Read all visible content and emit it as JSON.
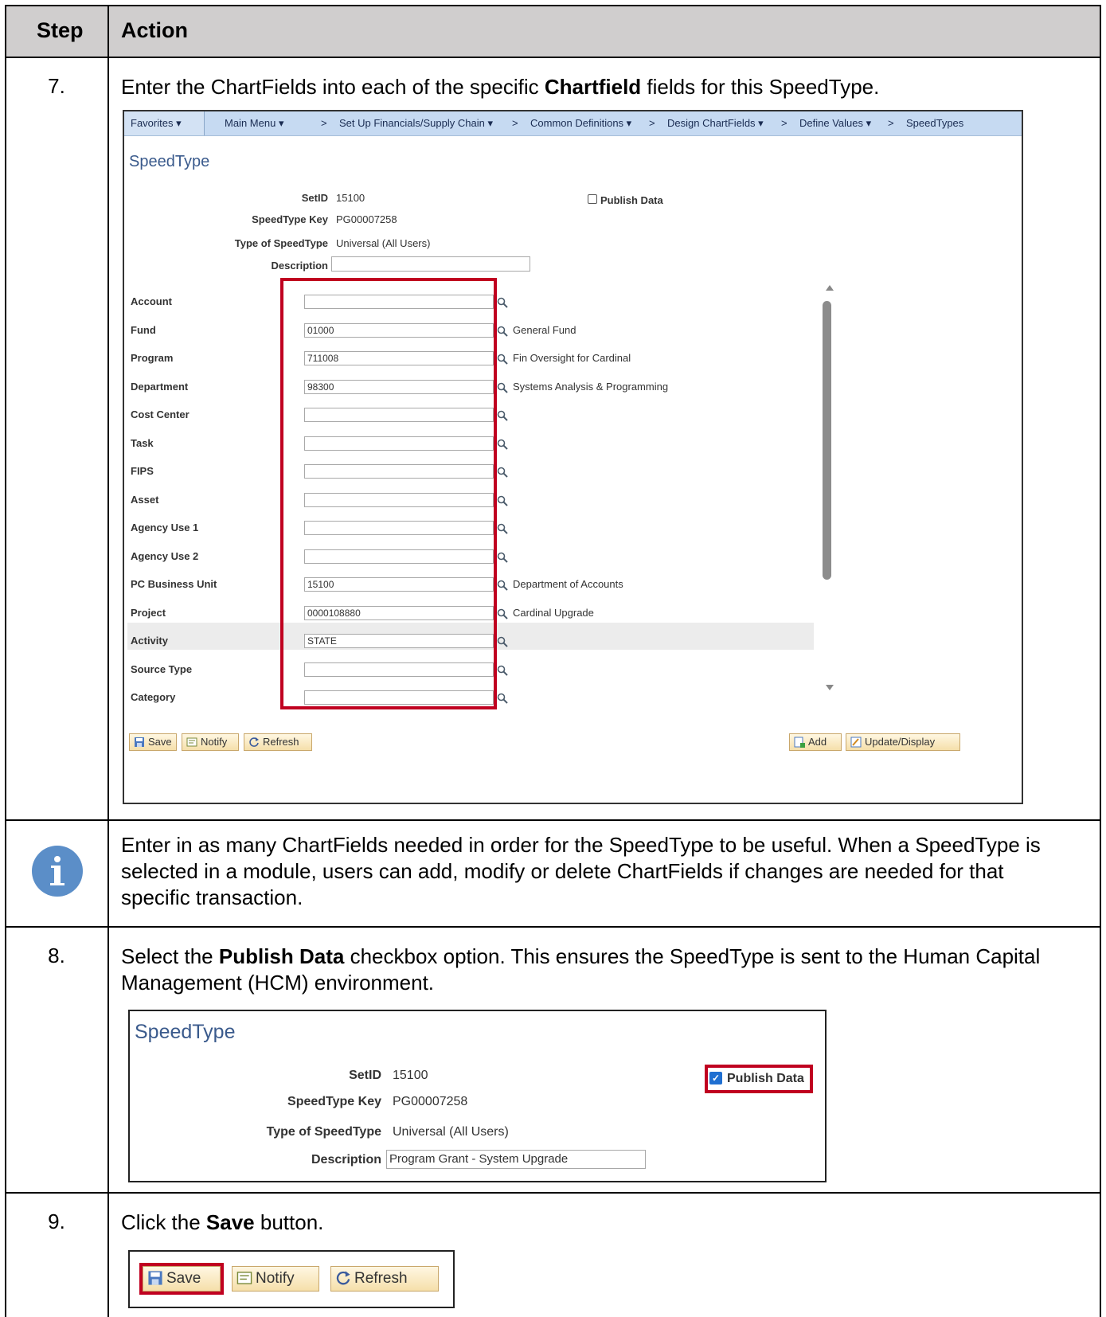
{
  "header": {
    "step": "Step",
    "action": "Action"
  },
  "rows": [
    {
      "step": "7.",
      "pre": "Enter the ChartFields into each of the specific ",
      "bold": "Chartfield",
      "post": " fields for this SpeedType."
    },
    {
      "note": "Enter in as many ChartFields needed in order for the SpeedType to be useful. When a SpeedType is selected in a module, users can add, modify or delete ChartFields if changes are needed for that specific transaction."
    },
    {
      "step": "8.",
      "pre": "Select the ",
      "bold": "Publish Data",
      "post": " checkbox option. This ensures the SpeedType is sent to the Human Capital Management (HCM) environment."
    },
    {
      "step": "9.",
      "pre": "Click the ",
      "bold": "Save",
      "post": " button."
    }
  ],
  "nav": {
    "favorites": "Favorites",
    "main_menu": "Main Menu",
    "crumbs": [
      "Set Up Financials/Supply Chain",
      "Common Definitions",
      "Design ChartFields",
      "Define Values",
      "SpeedTypes"
    ],
    "sep": ">",
    "caret": "▾"
  },
  "form1": {
    "title": "SpeedType",
    "setid_label": "SetID",
    "setid_value": "15100",
    "key_label": "SpeedType Key",
    "key_value": "PG00007258",
    "type_label": "Type of SpeedType",
    "type_value": "Universal (All Users)",
    "desc_label": "Description",
    "desc_value": "",
    "publish_label": "Publish Data",
    "publish_checked": false,
    "fields": [
      {
        "label": "Account",
        "value": "",
        "desc": ""
      },
      {
        "label": "Fund",
        "value": "01000",
        "desc": "General Fund"
      },
      {
        "label": "Program",
        "value": "711008",
        "desc": "Fin Oversight for Cardinal"
      },
      {
        "label": "Department",
        "value": "98300",
        "desc": "Systems Analysis & Programming"
      },
      {
        "label": "Cost Center",
        "value": "",
        "desc": ""
      },
      {
        "label": "Task",
        "value": "",
        "desc": ""
      },
      {
        "label": "FIPS",
        "value": "",
        "desc": ""
      },
      {
        "label": "Asset",
        "value": "",
        "desc": ""
      },
      {
        "label": "Agency Use 1",
        "value": "",
        "desc": ""
      },
      {
        "label": "Agency Use 2",
        "value": "",
        "desc": ""
      },
      {
        "label": "PC Business Unit",
        "value": "15100",
        "desc": "Department of Accounts"
      },
      {
        "label": "Project",
        "value": "0000108880",
        "desc": "Cardinal Upgrade"
      },
      {
        "label": "Activity",
        "value": "STATE",
        "desc": ""
      },
      {
        "label": "Source Type",
        "value": "",
        "desc": ""
      },
      {
        "label": "Category",
        "value": "",
        "desc": ""
      }
    ],
    "buttons": {
      "save": "Save",
      "notify": "Notify",
      "refresh": "Refresh",
      "add": "Add",
      "update": "Update/Display"
    }
  },
  "form2": {
    "title": "SpeedType",
    "setid_label": "SetID",
    "setid_value": "15100",
    "key_label": "SpeedType Key",
    "key_value": "PG00007258",
    "type_label": "Type of SpeedType",
    "type_value": "Universal (All Users)",
    "desc_label": "Description",
    "desc_value": "Program Grant - System Upgrade",
    "publish_label": "Publish Data",
    "publish_checked": true
  },
  "form3": {
    "save": "Save",
    "notify": "Notify",
    "refresh": "Refresh"
  },
  "colors": {
    "header_bg": "#d0cece",
    "highlight": "#c00020",
    "nav_bg": "#c6daf2",
    "info_icon": "#5b8ec8"
  }
}
